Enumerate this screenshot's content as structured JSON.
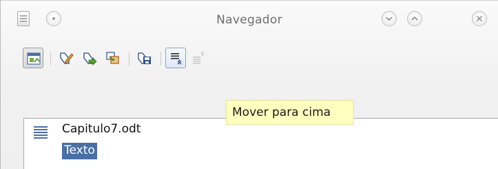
{
  "window": {
    "title": "Navegador",
    "icons": {
      "app": "document-icon",
      "menu": "window-menu-icon",
      "minimize": "minimize-icon",
      "maximize": "maximize-icon",
      "close": "close-icon"
    }
  },
  "toolbar": {
    "buttons": [
      {
        "icon": "navigation-toggle-icon",
        "state": "pressed"
      },
      {
        "icon": "edit-icon"
      },
      {
        "icon": "insert-icon"
      },
      {
        "icon": "link-icon"
      },
      {
        "icon": "save-icon"
      },
      {
        "icon": "move-up-icon",
        "state": "hover"
      },
      {
        "icon": "move-down-icon",
        "state": "disabled"
      }
    ]
  },
  "tooltip": {
    "text": "Mover para cima"
  },
  "tree": {
    "document": "Capitulo7.odt",
    "items": [
      {
        "label": "Texto",
        "selected": true
      }
    ]
  },
  "colors": {
    "selection": "#4a6fa5",
    "tooltip_bg": "#ffffbf"
  }
}
